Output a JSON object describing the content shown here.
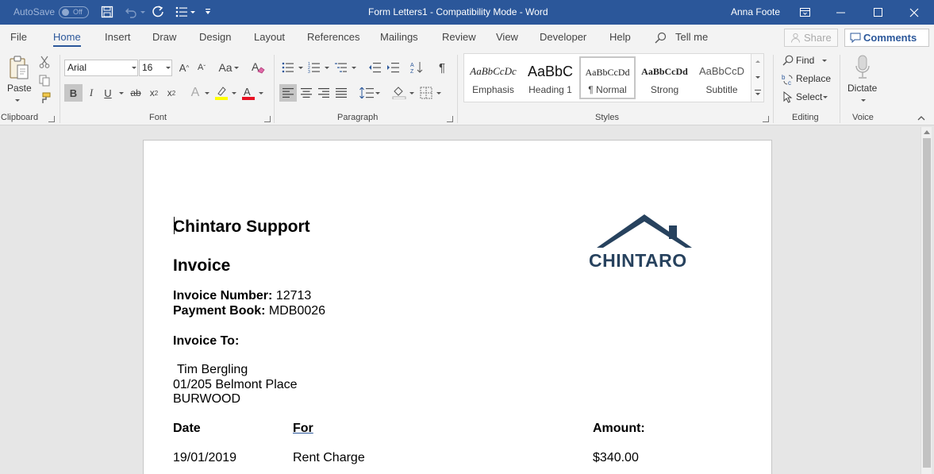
{
  "titlebar": {
    "autosave_label": "AutoSave",
    "autosave_state": "Off",
    "doc_title": "Form Letters1  -  Compatibility Mode  -  Word",
    "user_name": "Anna Foote"
  },
  "tabs": [
    "File",
    "Home",
    "Insert",
    "Draw",
    "Design",
    "Layout",
    "References",
    "Mailings",
    "Review",
    "View",
    "Developer",
    "Help"
  ],
  "active_tab": "Home",
  "tell_me": "Tell me",
  "share_label": "Share",
  "comments_label": "Comments",
  "ribbon": {
    "clipboard": {
      "paste_label": "Paste",
      "group_label": "Clipboard"
    },
    "font": {
      "font_name": "Arial",
      "font_size": "16",
      "group_label": "Font",
      "font_color": "#e81123",
      "highlight_color": "#ffff00"
    },
    "paragraph": {
      "group_label": "Paragraph"
    },
    "styles": {
      "group_label": "Styles",
      "items": [
        {
          "preview": "AaBbCcDc",
          "name": "Emphasis"
        },
        {
          "preview": "AaBbC",
          "name": "Heading 1"
        },
        {
          "preview": "AaBbCcDd",
          "name": "¶ Normal"
        },
        {
          "preview": "AaBbCcDd",
          "name": "Strong"
        },
        {
          "preview": "AaBbCcD",
          "name": "Subtitle"
        }
      ]
    },
    "editing": {
      "find_label": "Find",
      "replace_label": "Replace",
      "select_label": "Select",
      "group_label": "Editing"
    },
    "voice": {
      "dictate_label": "Dictate",
      "group_label": "Voice"
    }
  },
  "document": {
    "company": "Chintaro Support",
    "heading": "Invoice",
    "invoice_number_label": "Invoice Number:",
    "invoice_number": "12713",
    "payment_book_label": "Payment Book:",
    "payment_book": "MDB0026",
    "invoice_to_label": "Invoice To:",
    "recipient_name": "Tim Bergling",
    "address_line": "01/205 Belmont Place",
    "suburb": "BURWOOD",
    "columns": {
      "date": "Date",
      "for": "For",
      "amount": "Amount:"
    },
    "row": {
      "date": "19/01/2019",
      "for": "Rent Charge",
      "amount": "$340.00"
    },
    "logo_text": "CHINTARO",
    "logo_color": "#27425e"
  }
}
